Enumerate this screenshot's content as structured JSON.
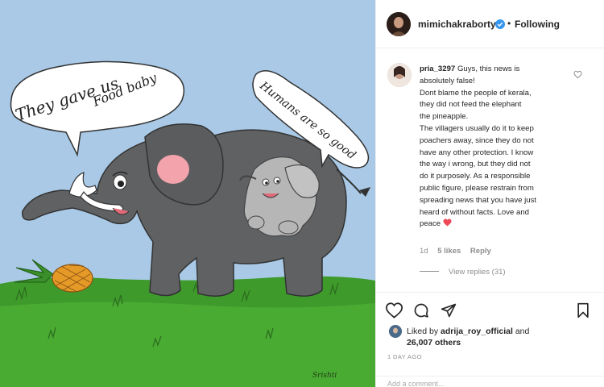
{
  "post": {
    "author": "mimichakraborty",
    "separator": "•",
    "follow_status": "Following",
    "artwork": {
      "bubble_left_text": [
        "They gave us",
        "Food baby"
      ],
      "bubble_right_text": "Humans are so good",
      "signature": "Srishti",
      "colors": {
        "sky": "#a9c9e6",
        "grass": "#3f9a2c",
        "elephant": "#5f6163",
        "baby_elephant": "#b6b6b6"
      }
    },
    "comment": {
      "username": "pria_3297",
      "text_lines": [
        "Guys, this news is",
        "absolutely false!",
        "Dont blame the people of kerala,",
        "they did not feed the elephant",
        "the pineapple.",
        "The villagers usually do it to keep",
        "poachers away, since they do not",
        "have any other protection. I know",
        "the way i wrong, but they did not",
        "do it purposely. As a responsible",
        "public figure, please restrain from",
        "spreading news that you have just",
        "heard of without facts. Love and",
        "peace"
      ],
      "age": "1d",
      "likes": "5 likes",
      "reply": "Reply",
      "view_replies": "View replies (31)"
    },
    "liked_by": {
      "prefix": "Liked by",
      "user": "adrija_roy_official",
      "conjunction": "and",
      "others": "26,007 others"
    },
    "timestamp": "1 DAY AGO",
    "add_comment_placeholder": "Add a comment...",
    "icons": [
      "heart-outline-icon",
      "comment-icon",
      "share-icon",
      "bookmark-icon",
      "verified-badge-icon",
      "heart-red-icon"
    ],
    "colors": {
      "verified": "#3897f0",
      "heart_red": "#ed4956",
      "muted": "#8e8e8e",
      "text": "#262626"
    }
  }
}
